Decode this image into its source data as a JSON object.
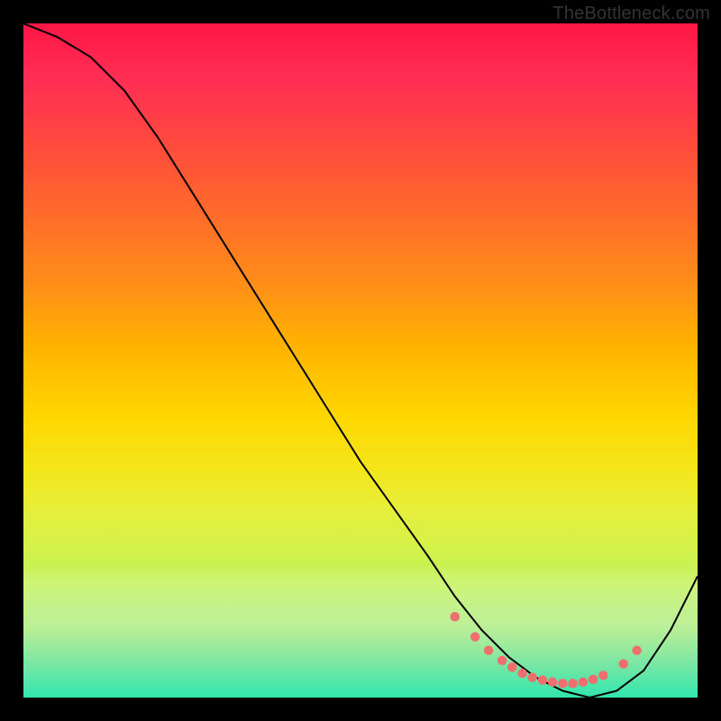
{
  "watermark": "TheBottleneck.com",
  "gradient": {
    "top_color": "#ff1744",
    "mid_color": "#ffd600",
    "bottom_color": "#1ec77e"
  },
  "curve_color": "#000000",
  "dot_color": "#ef6f6f",
  "chart_data": {
    "type": "line",
    "title": "",
    "xlabel": "",
    "ylabel": "",
    "xlim": [
      0,
      100
    ],
    "ylim": [
      0,
      100
    ],
    "series": [
      {
        "name": "curve",
        "x": [
          0,
          5,
          10,
          15,
          20,
          25,
          30,
          35,
          40,
          45,
          50,
          55,
          60,
          64,
          68,
          72,
          76,
          80,
          84,
          88,
          92,
          96,
          100
        ],
        "values": [
          100,
          98,
          95,
          90,
          83,
          75,
          67,
          59,
          51,
          43,
          35,
          28,
          21,
          15,
          10,
          6,
          3,
          1,
          0,
          1,
          4,
          10,
          18
        ]
      }
    ],
    "highlight_dots": {
      "name": "dots",
      "x": [
        64,
        67,
        69,
        71,
        72.5,
        74,
        75.5,
        77,
        78.5,
        80,
        81.5,
        83,
        84.5,
        86,
        89,
        91
      ],
      "values": [
        12,
        9,
        7,
        5.5,
        4.5,
        3.6,
        3.0,
        2.6,
        2.3,
        2.1,
        2.1,
        2.3,
        2.7,
        3.3,
        5.0,
        7.0
      ]
    }
  }
}
